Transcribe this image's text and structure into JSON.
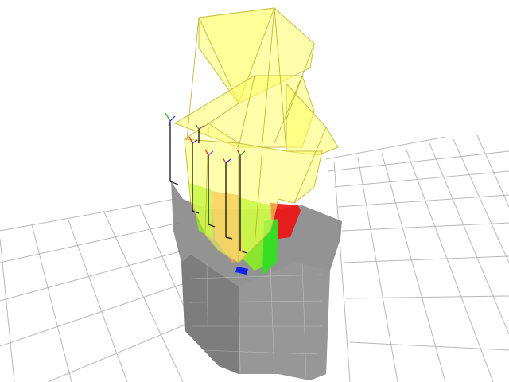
{
  "viewport": {
    "background": "#ffffff"
  },
  "colors": {
    "grid": "#b8b8b8",
    "cloud": "#808080",
    "hull_fill": "#ffff66",
    "hull_stroke": "#d8d040",
    "frame_axes": "#000000",
    "segment_green": "#33dd22",
    "segment_lime": "#88ee22",
    "segment_orange": "#f0a060",
    "segment_red": "#ee1111",
    "segment_blue": "#1122ee",
    "axis_x": "#ee2222",
    "axis_y": "#22aa22",
    "axis_z": "#2222ee",
    "axis_m": "#cc22cc"
  },
  "icons": {
    "grid": "ground-grid",
    "cloud": "point-cloud",
    "hull": "camera-frustum-hull",
    "frames": "coordinate-frame-axes"
  }
}
